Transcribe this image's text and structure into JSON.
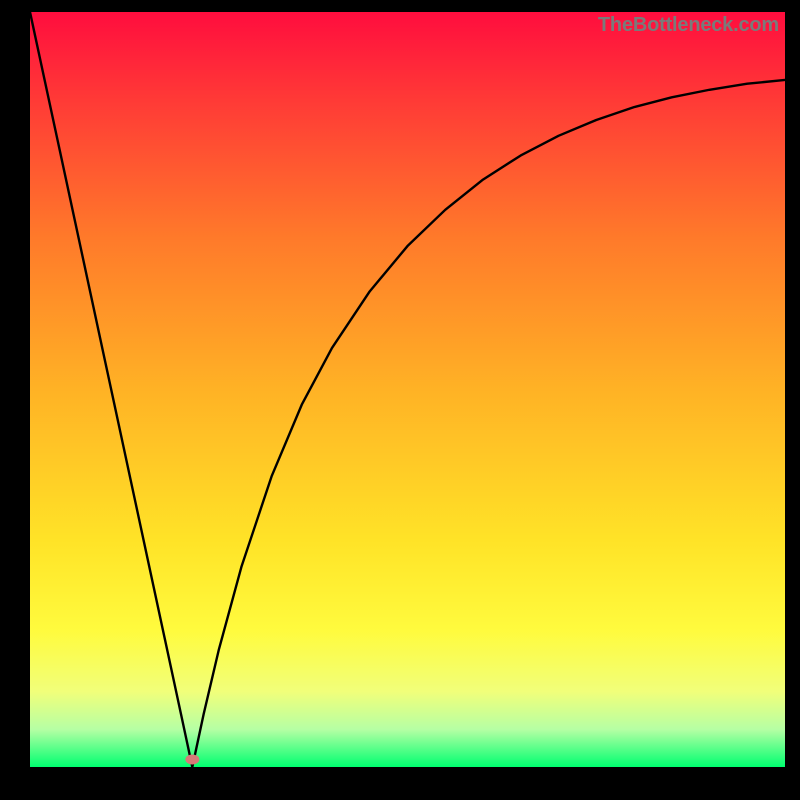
{
  "watermark": "TheBottleneck.com",
  "chart_data": {
    "type": "line",
    "title": "",
    "xlabel": "",
    "ylabel": "",
    "xlim": [
      0,
      100
    ],
    "ylim": [
      0,
      100
    ],
    "grid": false,
    "legend": false,
    "background_gradient": {
      "stops": [
        {
          "pos": 0.0,
          "color": "#ff0d3e"
        },
        {
          "pos": 0.12,
          "color": "#ff3b36"
        },
        {
          "pos": 0.3,
          "color": "#ff7a2a"
        },
        {
          "pos": 0.5,
          "color": "#ffb225"
        },
        {
          "pos": 0.7,
          "color": "#ffe327"
        },
        {
          "pos": 0.82,
          "color": "#fffb3e"
        },
        {
          "pos": 0.9,
          "color": "#f1ff7a"
        },
        {
          "pos": 0.95,
          "color": "#b6ffa4"
        },
        {
          "pos": 1.0,
          "color": "#00ff70"
        }
      ]
    },
    "marker": {
      "x": 21.5,
      "y": 1.0,
      "color": "#d77a78",
      "rx": 7,
      "ry": 5
    },
    "curve": {
      "points": [
        {
          "x": 0.0,
          "y": 100.0
        },
        {
          "x": 2.0,
          "y": 90.7
        },
        {
          "x": 4.0,
          "y": 81.4
        },
        {
          "x": 6.0,
          "y": 72.1
        },
        {
          "x": 8.0,
          "y": 62.8
        },
        {
          "x": 10.0,
          "y": 53.5
        },
        {
          "x": 12.0,
          "y": 44.2
        },
        {
          "x": 14.0,
          "y": 34.9
        },
        {
          "x": 16.0,
          "y": 25.6
        },
        {
          "x": 18.0,
          "y": 16.3
        },
        {
          "x": 20.0,
          "y": 7.0
        },
        {
          "x": 21.5,
          "y": 0.0
        },
        {
          "x": 23.0,
          "y": 7.0
        },
        {
          "x": 25.0,
          "y": 15.5
        },
        {
          "x": 28.0,
          "y": 26.5
        },
        {
          "x": 32.0,
          "y": 38.5
        },
        {
          "x": 36.0,
          "y": 48.0
        },
        {
          "x": 40.0,
          "y": 55.5
        },
        {
          "x": 45.0,
          "y": 63.0
        },
        {
          "x": 50.0,
          "y": 69.0
        },
        {
          "x": 55.0,
          "y": 73.8
        },
        {
          "x": 60.0,
          "y": 77.8
        },
        {
          "x": 65.0,
          "y": 81.0
        },
        {
          "x": 70.0,
          "y": 83.6
        },
        {
          "x": 75.0,
          "y": 85.7
        },
        {
          "x": 80.0,
          "y": 87.4
        },
        {
          "x": 85.0,
          "y": 88.7
        },
        {
          "x": 90.0,
          "y": 89.7
        },
        {
          "x": 95.0,
          "y": 90.5
        },
        {
          "x": 100.0,
          "y": 91.0
        }
      ]
    }
  }
}
